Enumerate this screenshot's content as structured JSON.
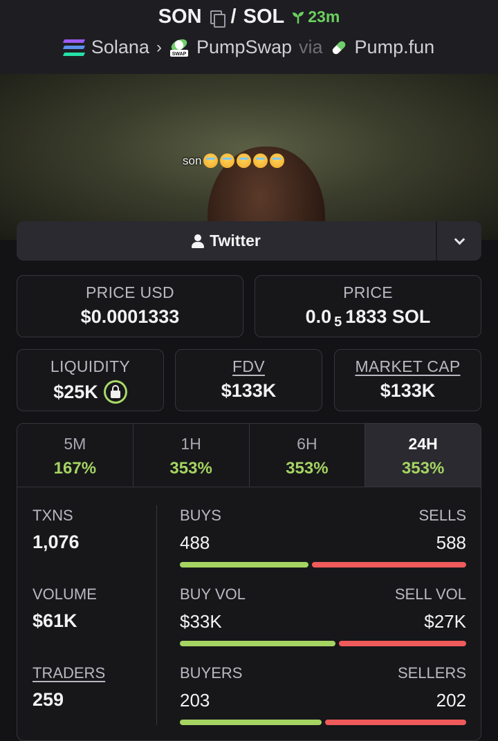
{
  "header": {
    "base": "SON",
    "quote": "SOL",
    "age": "23m",
    "chain": "Solana",
    "dex": "PumpSwap",
    "via": "via",
    "launchpad": "Pump.fun"
  },
  "banner": {
    "caption": "son"
  },
  "social": {
    "twitter_label": "Twitter"
  },
  "prices": {
    "price_usd_label": "PRICE USD",
    "price_usd": "$0.0001333",
    "price_label": "PRICE",
    "price_prefix": "0.0",
    "price_zeros": "5",
    "price_suffix": "1833 SOL"
  },
  "market": {
    "liquidity_label": "LIQUIDITY",
    "liquidity": "$25K",
    "fdv_label": "FDV",
    "fdv": "$133K",
    "mcap_label": "MARKET CAP",
    "mcap": "$133K"
  },
  "timeframes": [
    {
      "label": "5M",
      "change": "167%"
    },
    {
      "label": "1H",
      "change": "353%"
    },
    {
      "label": "6H",
      "change": "353%"
    },
    {
      "label": "24H",
      "change": "353%"
    }
  ],
  "active_timeframe": "24H",
  "stats": {
    "txns_label": "TXNS",
    "txns": "1,076",
    "volume_label": "VOLUME",
    "volume": "$61K",
    "traders_label": "TRADERS",
    "traders": "259",
    "buys_label": "BUYS",
    "buys": "488",
    "sells_label": "SELLS",
    "sells": "588",
    "buys_ratio": 0.454,
    "buyvol_label": "BUY VOL",
    "buyvol": "$33K",
    "sellvol_label": "SELL VOL",
    "sellvol": "$27K",
    "buyvol_ratio": 0.55,
    "buyers_label": "BUYERS",
    "buyers": "203",
    "sellers_label": "SELLERS",
    "sellers": "202",
    "buyers_ratio": 0.501
  },
  "colors": {
    "positive": "#a5d462",
    "negative": "#ef5a5a",
    "age": "#6ccf5f"
  }
}
